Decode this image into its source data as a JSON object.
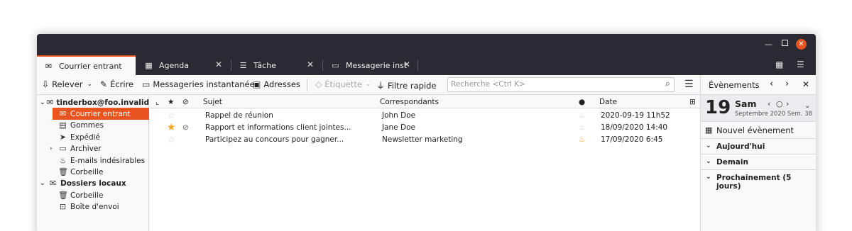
{
  "tabs": [
    {
      "label": "Courrier entrant",
      "icon": "inbox-icon"
    },
    {
      "label": "Agenda",
      "icon": "calendar-icon"
    },
    {
      "label": "Tâche",
      "icon": "tasks-icon"
    },
    {
      "label": "Messagerie inst",
      "icon": "chat-icon"
    }
  ],
  "toolbar": {
    "get_messages": "Relever",
    "write": "Écrire",
    "chat": "Messageries instantanée",
    "address_book": "Adresses",
    "tag": "Étiquette",
    "quick_filter": "Filtre rapide",
    "search_placeholder": "Recherche <Ctrl K>"
  },
  "folders": [
    {
      "label": "tinderbox@foo.invalid",
      "type": "account"
    },
    {
      "label": "Courrier entrant",
      "selected": true
    },
    {
      "label": "Gommes"
    },
    {
      "label": "Expédié"
    },
    {
      "label": "Archiver"
    },
    {
      "label": "E-mails indésirables"
    },
    {
      "label": "Corbeille"
    },
    {
      "label": "Dossiers locaux",
      "type": "account"
    },
    {
      "label": "Corbeille"
    },
    {
      "label": "Boîte d'envoi"
    }
  ],
  "thread_columns": {
    "subject": "Sujet",
    "correspondents": "Correspondants",
    "date": "Date"
  },
  "messages": [
    {
      "subject": "Rappel de réunion",
      "from": "John Doe",
      "date": "2020-09-19 11h52",
      "starred": false,
      "attachment": false,
      "junk": false
    },
    {
      "subject": "Rapport et informations client jointes...",
      "from": "Jane Doe",
      "date": "18/09/2020 14:40",
      "starred": true,
      "attachment": true,
      "junk": false
    },
    {
      "subject": "Participez au concours pour gagner...",
      "from": "Newsletter marketing",
      "date": "17/09/2020 6:45",
      "starred": false,
      "attachment": false,
      "junk": true
    }
  ],
  "today_pane": {
    "title": "Évènements",
    "day_number": "19",
    "weekday": "Sam",
    "subtitle": "Septembre 2020 Sem. 38",
    "new_event": "Nouvel évènement",
    "sections": [
      "Aujourd'hui",
      "Demain",
      "Prochainement (5 jours)"
    ]
  },
  "colors": {
    "accent": "#e95420",
    "titlebar": "#2b2a33",
    "star": "#f5a623"
  }
}
